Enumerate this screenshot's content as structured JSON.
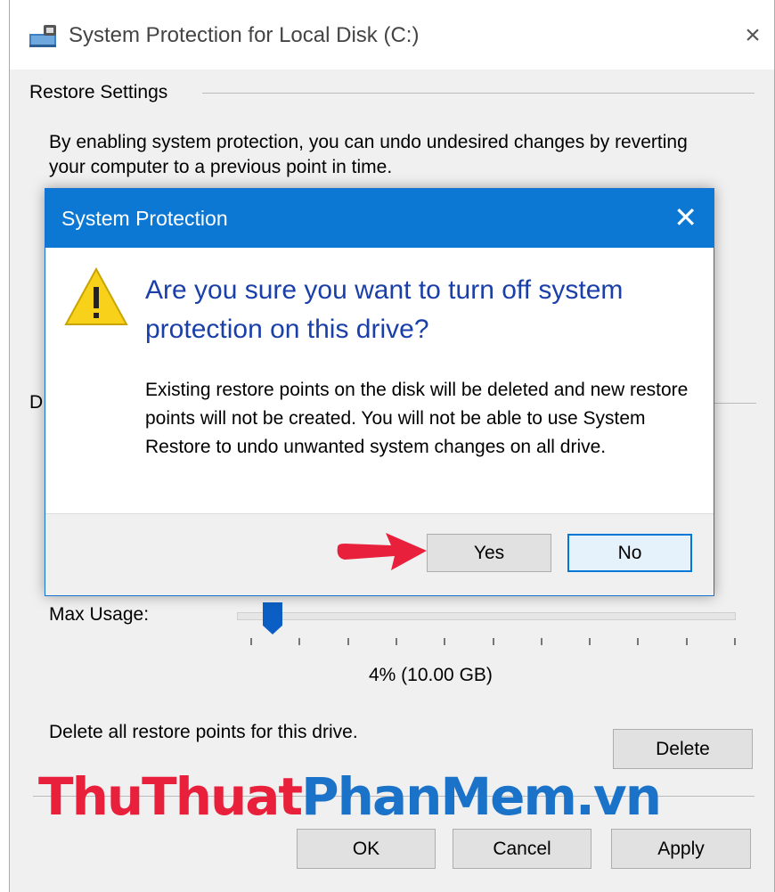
{
  "window": {
    "title": "System Protection for Local Disk (C:)",
    "close_glyph": "×"
  },
  "restore_settings": {
    "heading": "Restore Settings",
    "description": "By enabling system protection, you can undo undesired changes by reverting your computer to a previous point in time."
  },
  "disk_space": {
    "heading_partial": "D",
    "max_usage_label": "Max Usage:",
    "max_usage_fraction": 0.04,
    "max_usage_value": "4% (10.00 GB)",
    "delete_text": "Delete all restore points for this drive.",
    "delete_button": "Delete"
  },
  "footer": {
    "ok": "OK",
    "cancel": "Cancel",
    "apply": "Apply"
  },
  "watermark": {
    "part1": "ThuThuat",
    "part2": "PhanMem.vn"
  },
  "dialog": {
    "title": "System Protection",
    "close_glyph": "✕",
    "question": "Are you sure you want to turn off system protection on this drive?",
    "detail": "Existing restore points on the disk will be deleted and new restore points will not be created. You will not be able to use System Restore to undo unwanted system changes on all drive.",
    "yes": "Yes",
    "no": "No"
  },
  "icons": {
    "app": "system-protection-icon",
    "warning": "warning-triangle-icon",
    "pointer": "red-arrow-icon"
  },
  "colors": {
    "dialog_title_bar": "#0c78d4",
    "question_text": "#1a3fa8",
    "slider_thumb": "#0b5fc4",
    "watermark_red": "#e8203b",
    "watermark_blue": "#1a73c9",
    "arrow": "#e8203b"
  }
}
